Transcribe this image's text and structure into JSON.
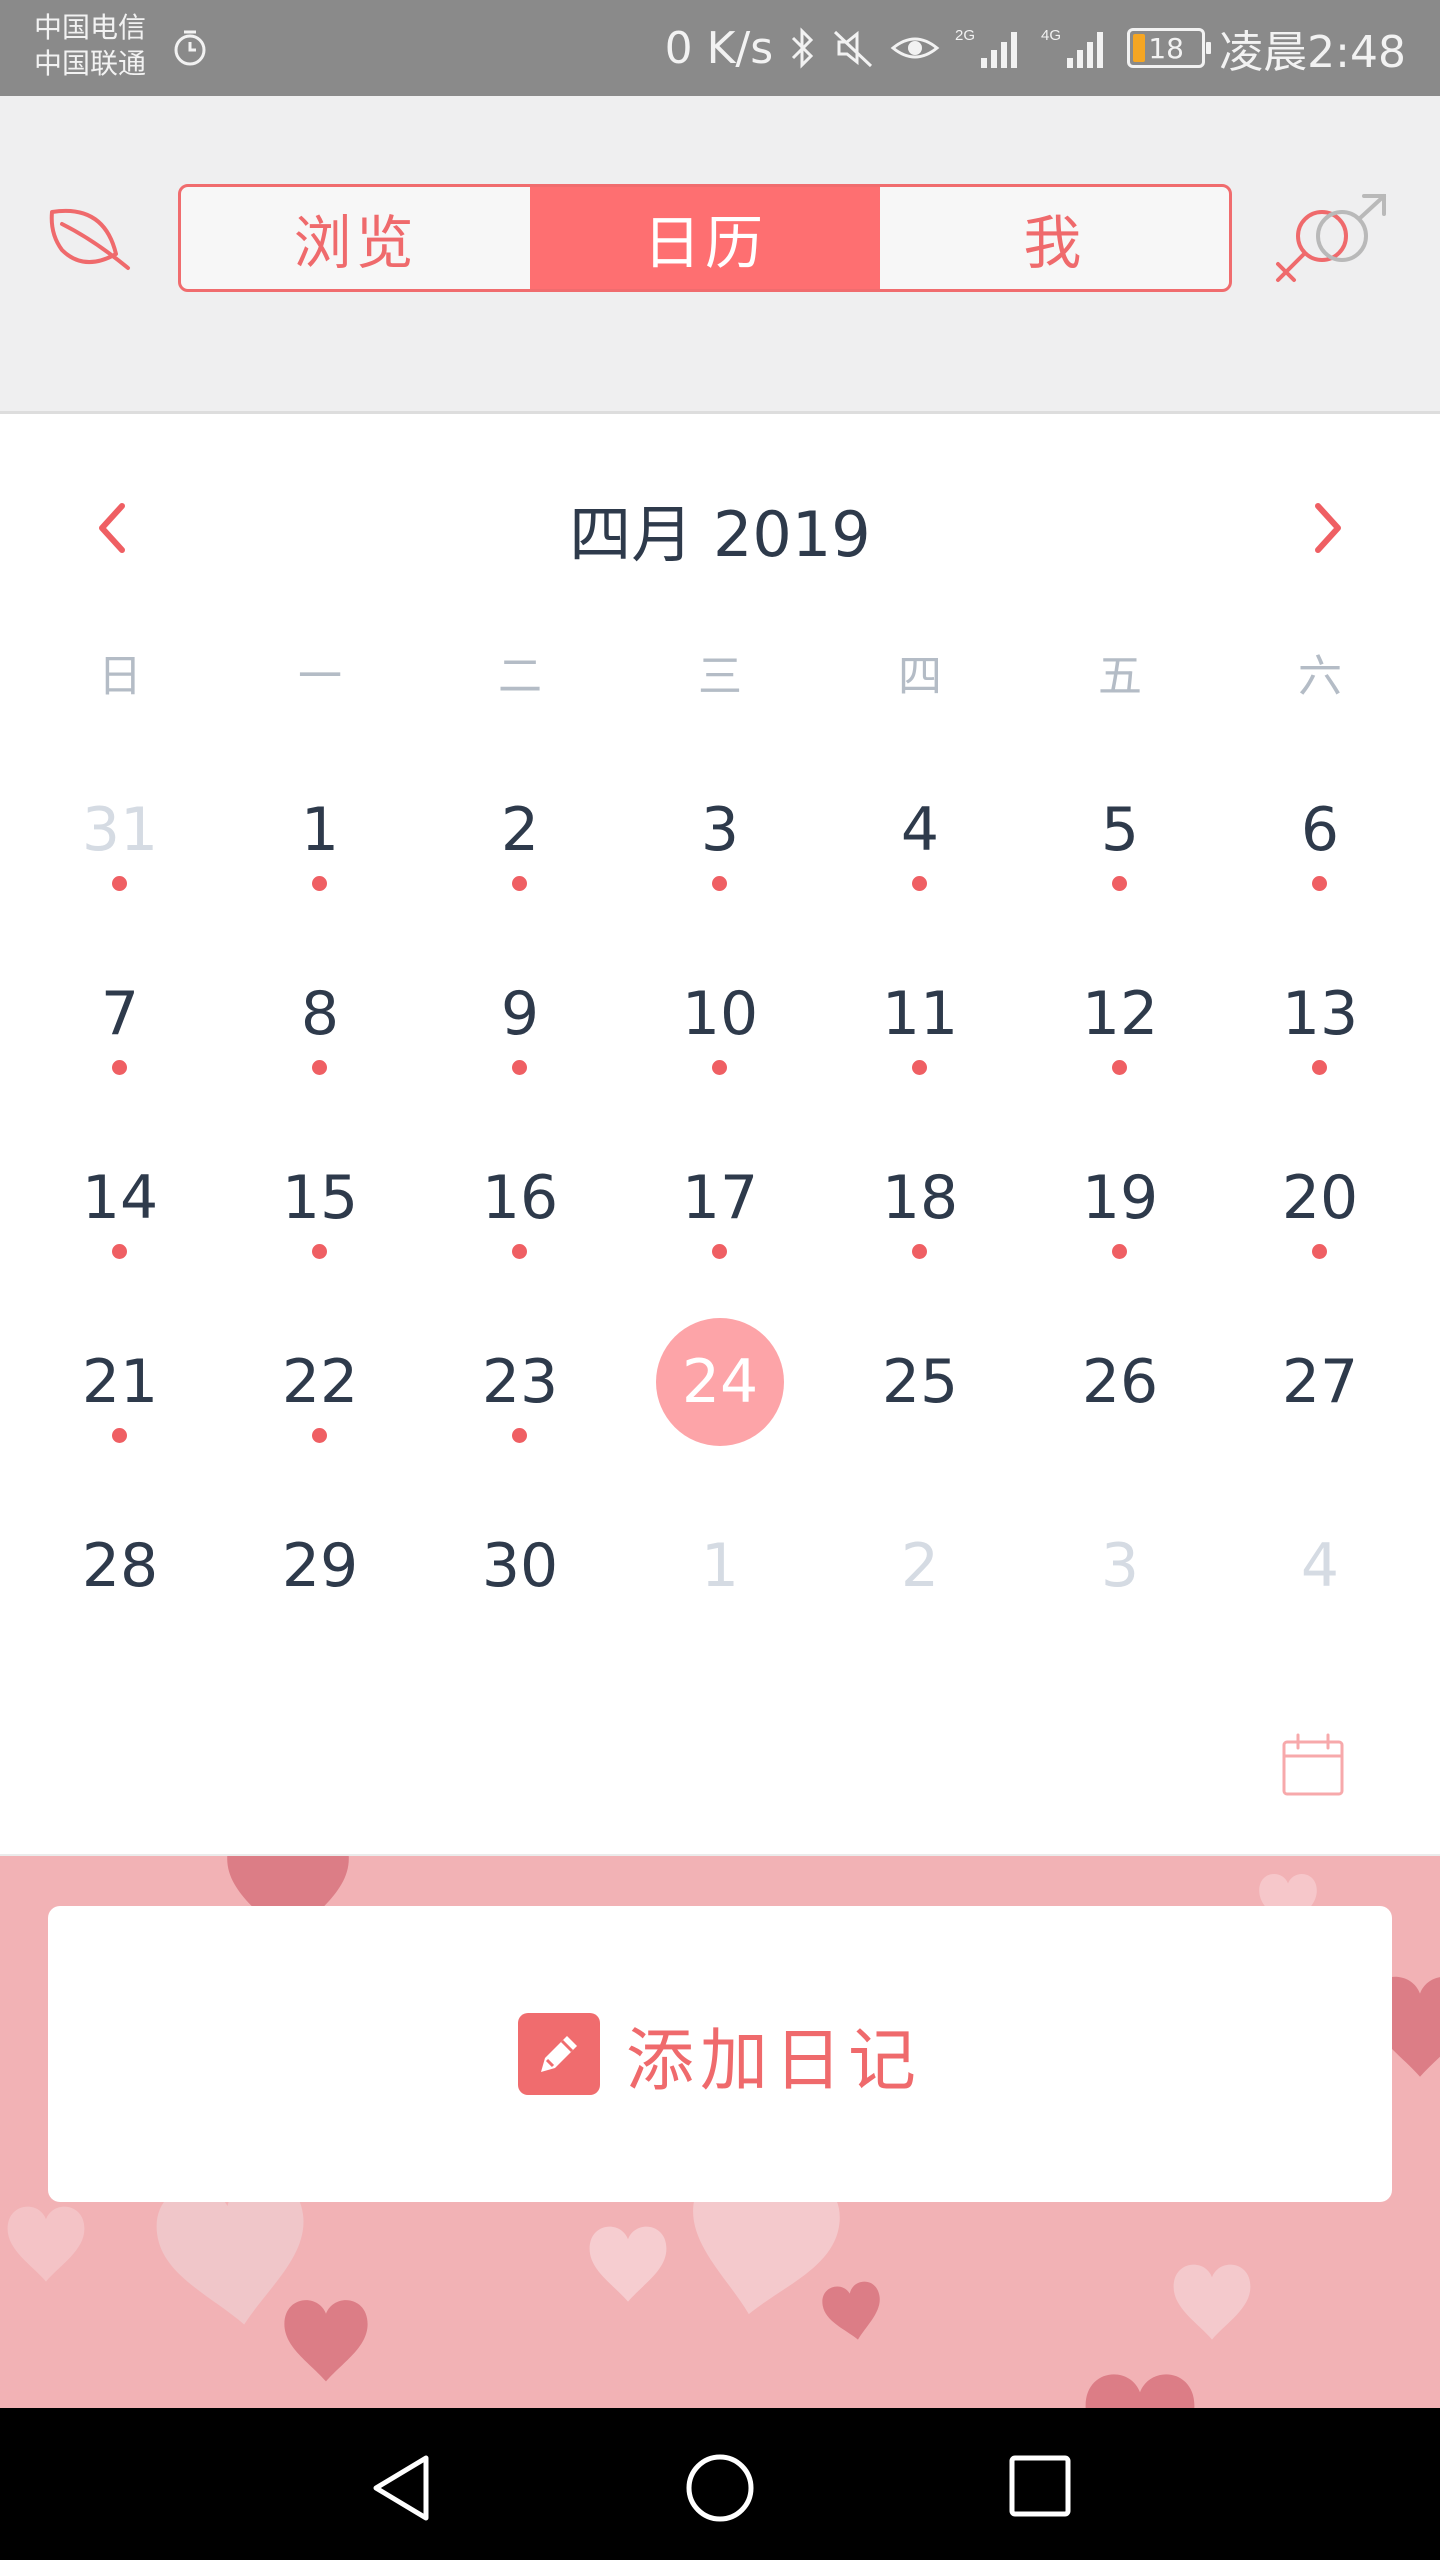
{
  "status_bar": {
    "carrier_1": "中国电信",
    "carrier_2": "中国联通",
    "net_speed": "0 K/s",
    "battery": "18",
    "time": "凌晨2:48",
    "signal_1": "2G",
    "signal_2": "4G"
  },
  "header": {
    "tabs": [
      {
        "label": "浏览",
        "active": false
      },
      {
        "label": "日历",
        "active": true
      },
      {
        "label": "我",
        "active": false
      }
    ]
  },
  "calendar": {
    "month_title": "四月 2019",
    "weekdays": [
      "日",
      "一",
      "二",
      "三",
      "四",
      "五",
      "六"
    ],
    "weeks": [
      [
        {
          "day": "31",
          "other": true,
          "dot": true
        },
        {
          "day": "1",
          "dot": true
        },
        {
          "day": "2",
          "dot": true
        },
        {
          "day": "3",
          "dot": true
        },
        {
          "day": "4",
          "dot": true
        },
        {
          "day": "5",
          "dot": true
        },
        {
          "day": "6",
          "dot": true
        }
      ],
      [
        {
          "day": "7",
          "dot": true
        },
        {
          "day": "8",
          "dot": true
        },
        {
          "day": "9",
          "dot": true
        },
        {
          "day": "10",
          "dot": true
        },
        {
          "day": "11",
          "dot": true
        },
        {
          "day": "12",
          "dot": true
        },
        {
          "day": "13",
          "dot": true
        }
      ],
      [
        {
          "day": "14",
          "dot": true
        },
        {
          "day": "15",
          "dot": true
        },
        {
          "day": "16",
          "dot": true
        },
        {
          "day": "17",
          "dot": true
        },
        {
          "day": "18",
          "dot": true
        },
        {
          "day": "19",
          "dot": true
        },
        {
          "day": "20",
          "dot": true
        }
      ],
      [
        {
          "day": "21",
          "dot": true
        },
        {
          "day": "22",
          "dot": true
        },
        {
          "day": "23",
          "dot": true
        },
        {
          "day": "24",
          "today": true
        },
        {
          "day": "25"
        },
        {
          "day": "26"
        },
        {
          "day": "27"
        }
      ],
      [
        {
          "day": "28"
        },
        {
          "day": "29"
        },
        {
          "day": "30"
        },
        {
          "day": "1",
          "other": true
        },
        {
          "day": "2",
          "other": true
        },
        {
          "day": "3",
          "other": true
        },
        {
          "day": "4",
          "other": true
        }
      ]
    ]
  },
  "diary": {
    "add_label": "添加日记"
  },
  "colors": {
    "accent": "#fe6f71",
    "today_circle": "#fda4a8",
    "banner_bg": "#f2b2b5"
  }
}
